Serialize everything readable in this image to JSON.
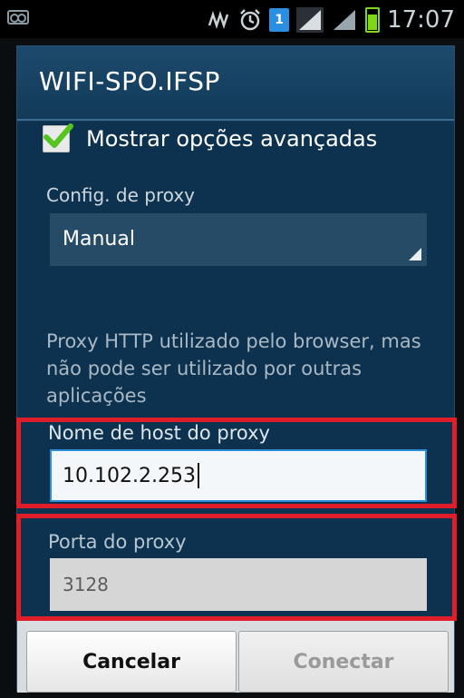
{
  "status_bar": {
    "time": "17:07",
    "sim_indicator": "1",
    "icons": [
      "voicemail-icon",
      "nfc-icon",
      "alarm-icon",
      "sim-icon",
      "signal-icon",
      "battery-icon"
    ]
  },
  "dialog": {
    "title": "WIFI-SPO.IFSP",
    "advanced_options": {
      "label": "Mostrar opções avançadas",
      "checked": true
    },
    "proxy_config": {
      "label": "Config. de proxy",
      "selected": "Manual"
    },
    "info_text": "Proxy HTTP utilizado pelo browser, mas não pode ser utilizado por outras aplicações",
    "host": {
      "label": "Nome de host do proxy",
      "value": "10.102.2.253"
    },
    "port": {
      "label": "Porta do proxy",
      "placeholder": "3128"
    }
  },
  "buttons": {
    "cancel": "Cancelar",
    "connect": "Conectar"
  },
  "colors": {
    "highlight": "#e01e2a",
    "dialog_bg": "#0f3552",
    "checkbox_green": "#56c41e",
    "input_focus": "#2e8fd8"
  }
}
